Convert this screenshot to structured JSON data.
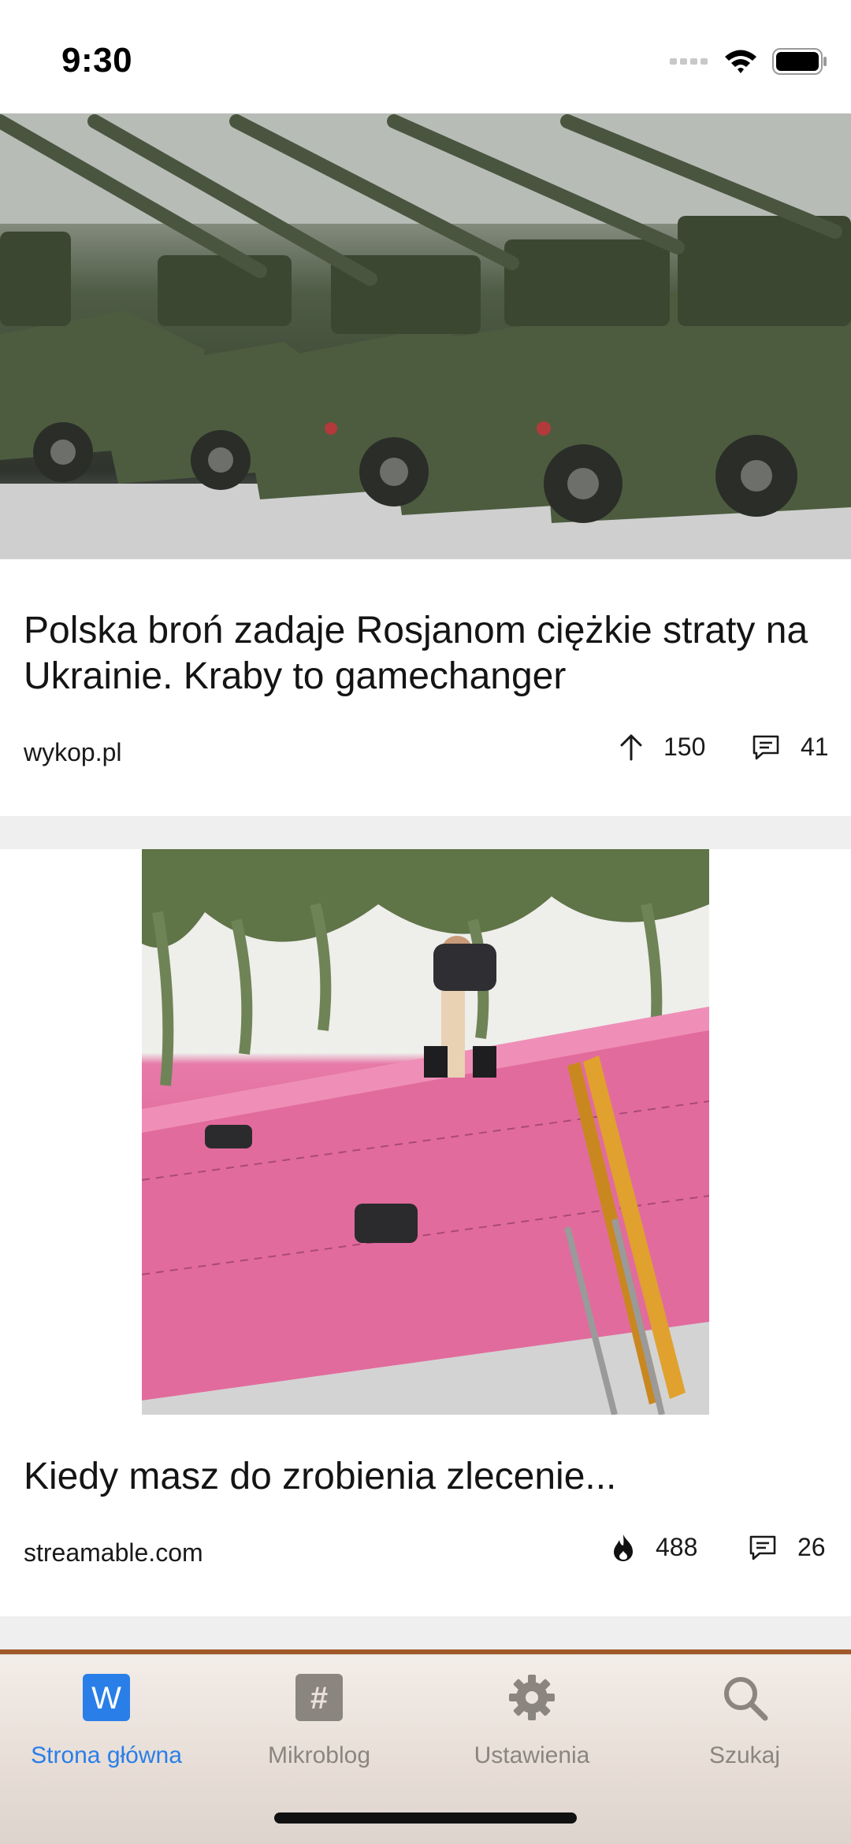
{
  "status": {
    "time": "9:30"
  },
  "feed": [
    {
      "title": "Polska broń zadaje Rosjanom ciężkie straty na Ukrainie. Kraby to gamechanger",
      "source": "wykop.pl",
      "votes": "150",
      "vote_icon": "upvote-arrow-icon",
      "comments": "41",
      "image": "row of green self-propelled howitzers"
    },
    {
      "title": "Kiedy masz do zrobienia zlecenie...",
      "source": "streamable.com",
      "votes": "488",
      "vote_icon": "hot-flame-icon",
      "comments": "26",
      "image": "worker on pink roofing panels"
    }
  ],
  "tabbar": {
    "items": [
      {
        "label": "Strona główna",
        "icon": "wykop-logo-icon",
        "active": true
      },
      {
        "label": "Mikroblog",
        "icon": "hashtag-icon",
        "active": false
      },
      {
        "label": "Ustawienia",
        "icon": "gear-icon",
        "active": false
      },
      {
        "label": "Szukaj",
        "icon": "search-icon",
        "active": false
      }
    ]
  },
  "colors": {
    "accent": "#2a7ee8",
    "inactive": "#8b857f",
    "separator": "#efefef"
  }
}
